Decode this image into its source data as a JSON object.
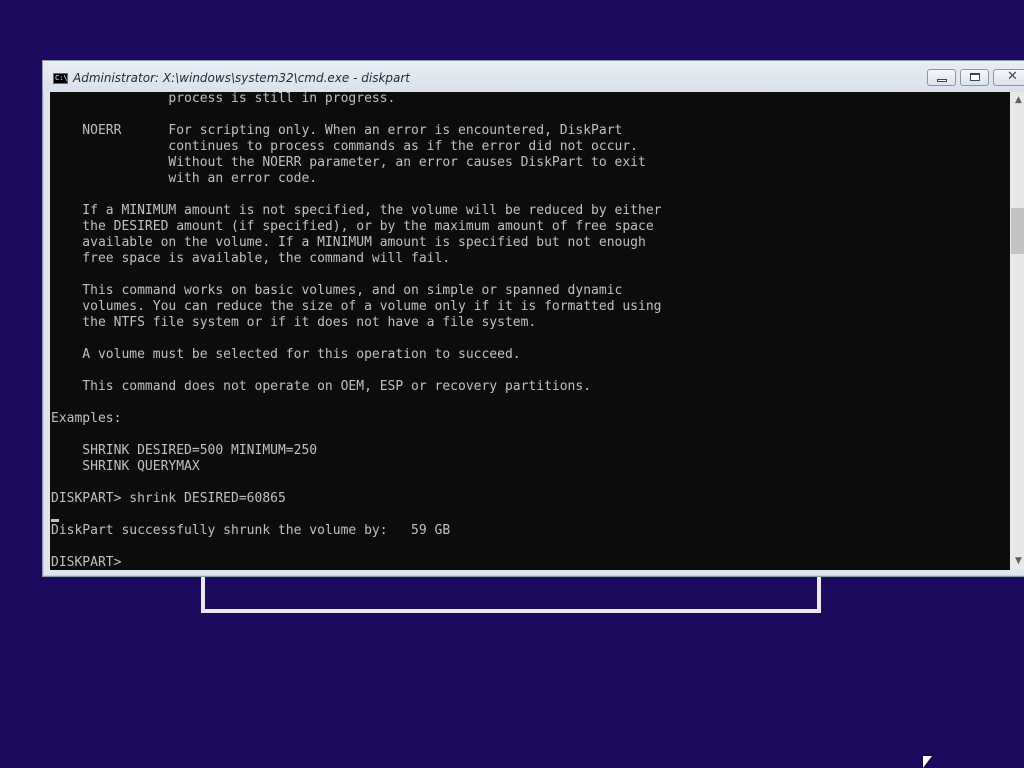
{
  "window": {
    "title": "Administrator: X:\\windows\\system32\\cmd.exe - diskpart",
    "icon": "cmd-icon",
    "icon_glyph": "C:\\",
    "controls": {
      "minimize": "minimize-icon",
      "maximize": "maximize-icon",
      "close": "close-icon",
      "close_glyph": "✕"
    }
  },
  "console": {
    "lines": [
      "               process is still in progress.",
      "",
      "    NOERR      For scripting only. When an error is encountered, DiskPart",
      "               continues to process commands as if the error did not occur.",
      "               Without the NOERR parameter, an error causes DiskPart to exit",
      "               with an error code.",
      "",
      "    If a MINIMUM amount is not specified, the volume will be reduced by either",
      "    the DESIRED amount (if specified), or by the maximum amount of free space",
      "    available on the volume. If a MINIMUM amount is specified but not enough",
      "    free space is available, the command will fail.",
      "",
      "    This command works on basic volumes, and on simple or spanned dynamic",
      "    volumes. You can reduce the size of a volume only if it is formatted using",
      "    the NTFS file system or if it does not have a file system.",
      "",
      "    A volume must be selected for this operation to succeed.",
      "",
      "    This command does not operate on OEM, ESP or recovery partitions.",
      "",
      "Examples:",
      "",
      "    SHRINK DESIRED=500 MINIMUM=250",
      "    SHRINK QUERYMAX",
      "",
      "DISKPART> shrink DESIRED=60865",
      "",
      "DiskPart successfully shrunk the volume by:   59 GB",
      "",
      "DISKPART> "
    ]
  },
  "scrollbar": {
    "up_glyph": "▲",
    "down_glyph": "▼"
  },
  "colors": {
    "desktop_background": "#1c0a5e",
    "console_background": "#0c0c0c",
    "console_text": "#c0c0c0"
  }
}
